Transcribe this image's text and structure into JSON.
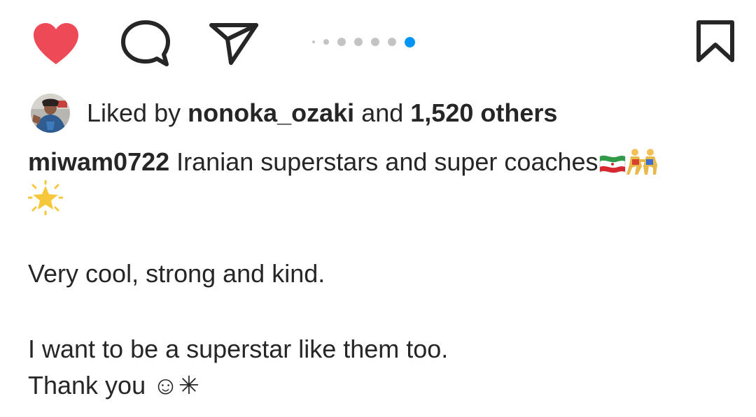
{
  "post_actions": {
    "like_icon": "heart-filled-icon",
    "comment_icon": "comment-bubble-icon",
    "share_icon": "paper-plane-icon",
    "save_icon": "bookmark-icon",
    "like_color": "#ed4956",
    "icon_color": "#262626"
  },
  "carousel": {
    "total": 7,
    "active_index": 6,
    "active_color": "#0095f6",
    "inactive_color": "#c4c4c4"
  },
  "likes": {
    "prefix": "Liked by",
    "user": "nonoka_ozaki",
    "conjunction": "and",
    "others": "1,520 others"
  },
  "caption": {
    "username": "miwam0722",
    "line1": "Iranian superstars and super coaches",
    "emojis": [
      "iran-flag-icon",
      "wrestlers-icon",
      "glowing-star-icon"
    ],
    "line2": "Very cool, strong and kind.",
    "line3": "I want to be a superstar like them too.",
    "line4": "Thank you ☺✳"
  }
}
